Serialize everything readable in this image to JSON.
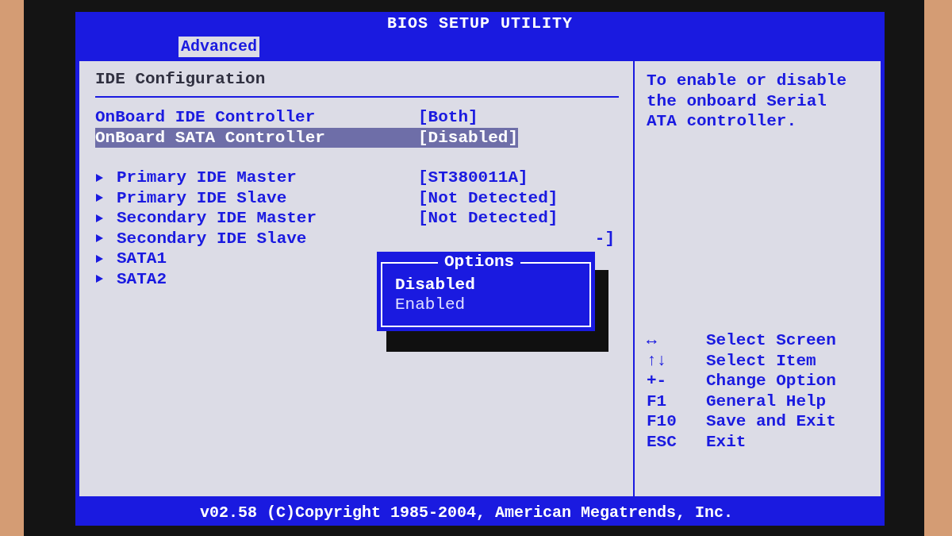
{
  "window": {
    "title": "BIOS SETUP UTILITY"
  },
  "tabs": [
    {
      "label": "Advanced",
      "selected": true
    }
  ],
  "section": {
    "title": "IDE Configuration"
  },
  "settings": [
    {
      "label": "OnBoard IDE Controller",
      "value": "[Both]",
      "selected": false
    },
    {
      "label": "OnBoard SATA Controller",
      "value": "[Disabled]",
      "selected": true
    }
  ],
  "submenus": [
    {
      "label": "Primary IDE Master",
      "value": "[ST380011A]",
      "kind": "row"
    },
    {
      "label": "Primary IDE Slave",
      "value": "[Not Detected]",
      "kind": "row"
    },
    {
      "label": "Secondary IDE Master",
      "value": "[Not Detected]",
      "kind": "row"
    },
    {
      "label": "Secondary IDE Slave",
      "value": "-]",
      "kind": "covered"
    },
    {
      "label": "SATA1",
      "kind": "row"
    },
    {
      "label": "SATA2",
      "kind": "row"
    }
  ],
  "popup": {
    "title": "Options",
    "options": [
      {
        "label": "Disabled",
        "selected": true
      },
      {
        "label": "Enabled",
        "selected": false
      }
    ]
  },
  "help": {
    "text": "To enable or disable the onboard Serial ATA controller."
  },
  "keys": [
    {
      "key": "↔",
      "action": "Select Screen"
    },
    {
      "key": "↑↓",
      "action": "Select Item"
    },
    {
      "key": "+-",
      "action": "Change Option"
    },
    {
      "key": "F1",
      "action": "General Help"
    },
    {
      "key": "F10",
      "action": "Save and Exit"
    },
    {
      "key": "ESC",
      "action": "Exit"
    }
  ],
  "status_bar": "v02.58 (C)Copyright 1985-2004, American Megatrends, Inc."
}
